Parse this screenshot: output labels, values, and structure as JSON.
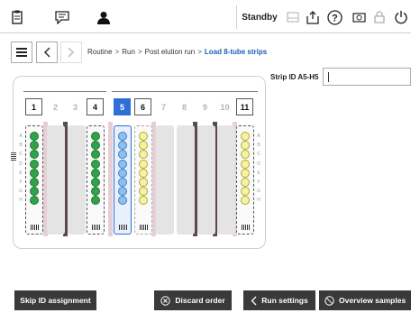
{
  "topbar": {
    "standby_label": "Standby"
  },
  "breadcrumb": {
    "items": [
      "Routine",
      "Run",
      "Post elution run"
    ],
    "current": "Load 8-tube strips"
  },
  "rack": {
    "slots": [
      "1",
      "2",
      "3",
      "4",
      "5",
      "6",
      "7",
      "8",
      "9",
      "10",
      "11"
    ],
    "selected_slot": "5",
    "active_slots": [
      "1",
      "4",
      "5",
      "6",
      "11"
    ],
    "row_letters": [
      "A",
      "B",
      "C",
      "D",
      "E",
      "F",
      "G",
      "H"
    ]
  },
  "strip_id": {
    "label": "Strip ID A5-H5",
    "value": ""
  },
  "buttons": {
    "skip_id": "Skip ID assignment",
    "discard": "Discard order",
    "run_settings": "Run settings",
    "overview": "Overview samples"
  },
  "colors": {
    "accent": "#2e6fd6",
    "well_green": "#2fa24a",
    "well_blue": "#8ec0ee",
    "well_yellow": "#f6f3a0",
    "button_dark": "#3a3a3a"
  }
}
